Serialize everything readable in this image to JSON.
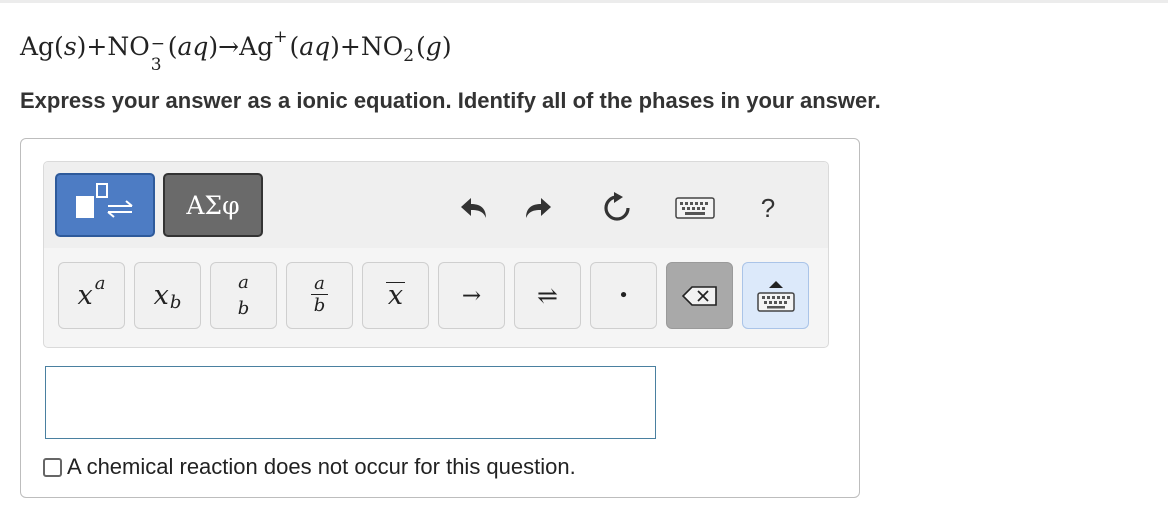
{
  "equation": {
    "silver_solid": "Ag(",
    "s": "s",
    "close1": ")+NO",
    "no3_charge": "−",
    "no3_count": "3",
    "open_aq1": "(",
    "aq1": "aq",
    "arrow_ag": ")→Ag",
    "ag_charge": "+",
    "open_aq2": "(",
    "aq2": "aq",
    "close_plus_no": ")+NO",
    "no2_count": "2",
    "open_g": "(",
    "g": "g",
    "close_g": ")"
  },
  "instruction": "Express your answer as a ionic equation. Identify all of the phases in your answer.",
  "toolbar": {
    "templates_icon": "templates-icon",
    "symbols_label": "ΑΣφ",
    "undo_icon": "undo-icon",
    "redo_icon": "redo-icon",
    "reset_icon": "reset-icon",
    "keyboard_shortcuts_icon": "keyboard-icon",
    "help_label": "?"
  },
  "keys": {
    "superscript": {
      "base": "x",
      "exp": "a"
    },
    "subscript": {
      "base": "x",
      "sub": "b"
    },
    "stacked": {
      "top": "a",
      "bottom": "b"
    },
    "fraction": {
      "top": "a",
      "bottom": "b"
    },
    "overline": {
      "base": "x"
    },
    "reaction_arrow": "→",
    "equilibrium_arrow": "⇌",
    "dot": "•",
    "delete_icon": "backspace-icon",
    "keyboard_icon": "keyboard-toggle-icon"
  },
  "answer": {
    "value": ""
  },
  "no_reaction": {
    "label": "A chemical reaction does not occur for this question.",
    "checked": false
  },
  "colors": {
    "templates_button": "#4d7cc4",
    "symbols_button": "#6a6a6a",
    "answer_border": "#4a80a0",
    "keyboard_key": "#dce9fa"
  }
}
